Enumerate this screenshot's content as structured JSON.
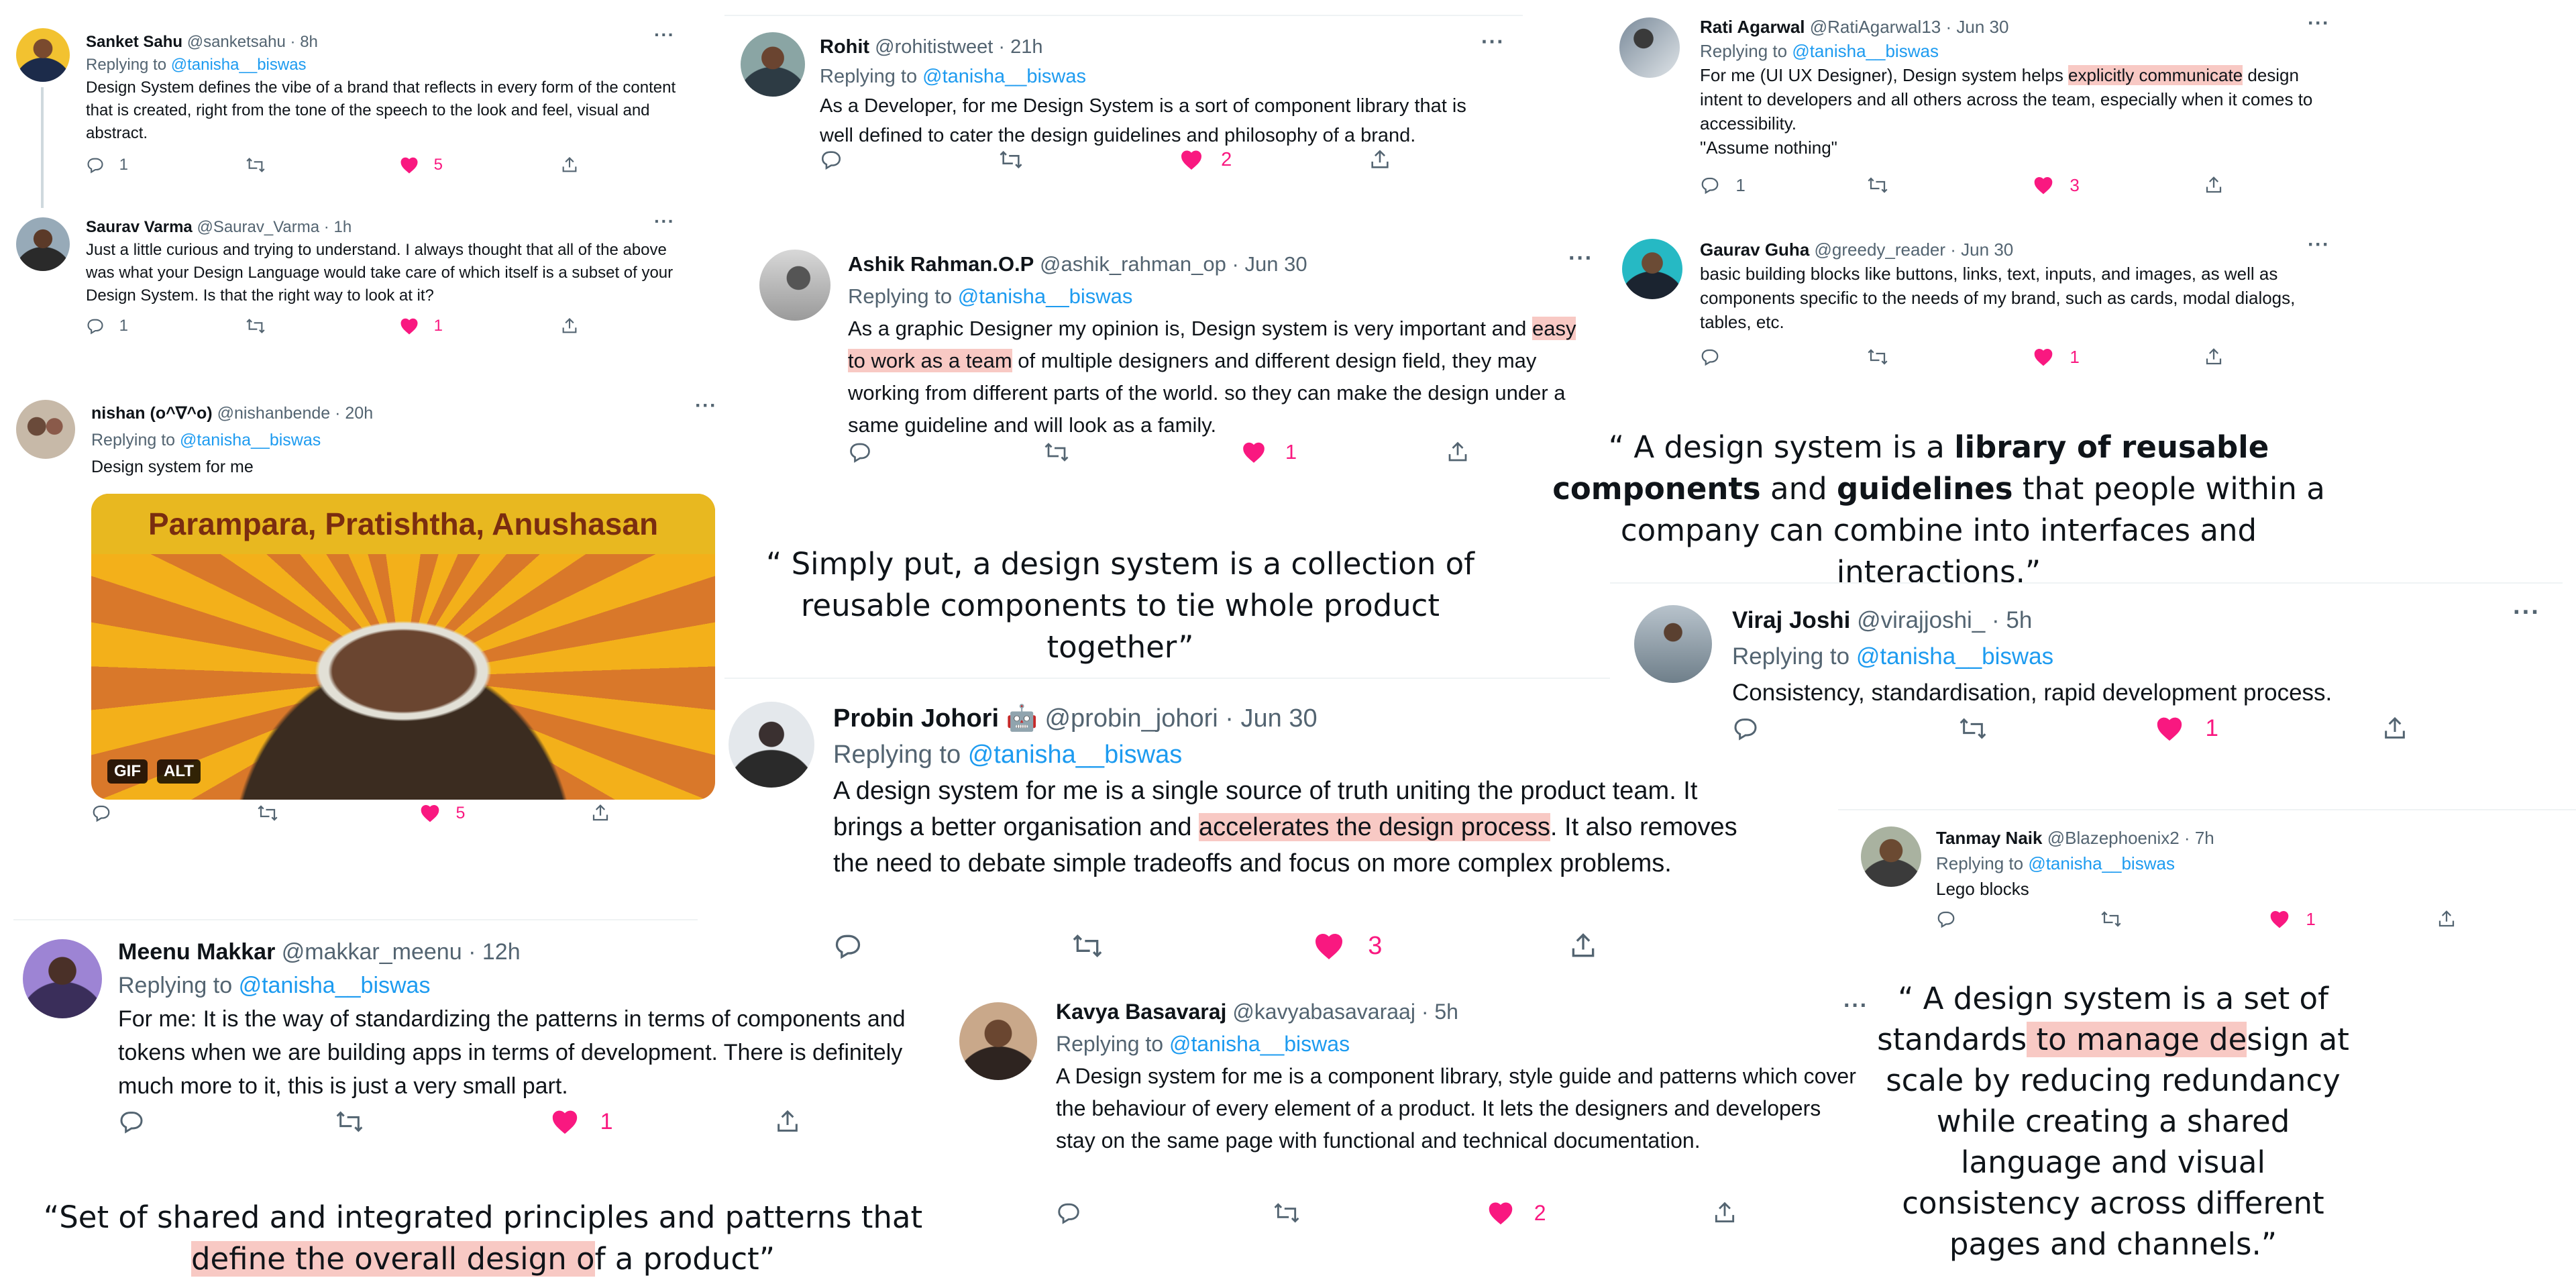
{
  "colors": {
    "accent": "#1d9bf0",
    "like": "#f91880",
    "highlight": "#f8c9c4",
    "muted": "#536471"
  },
  "tweets": {
    "sanket": {
      "name": "Sanket Sahu",
      "handle": "@sanketsahu",
      "dot": "·",
      "time": "8h",
      "replying": "Replying to",
      "mention": "@tanisha__biswas",
      "text": "Design System defines the vibe of a brand that reflects in every form of the content that is created, right from the tone of the speech to the look and feel, visual and abstract.",
      "replies": "1",
      "retweets": "",
      "likes": "5"
    },
    "saurav": {
      "name": "Saurav Varma",
      "handle": "@Saurav_Varma",
      "dot": "·",
      "time": "1h",
      "text": "Just a little curious and trying to understand. I always thought that all of the above was what your Design Language would take care of which itself is a subset of your Design System. Is that the right way to look at it?",
      "replies": "1",
      "retweets": "",
      "likes": "1"
    },
    "nishan": {
      "name": "nishan (o^∇^o)",
      "handle": "@nishanbende",
      "dot": "·",
      "time": "20h",
      "replying": "Replying to",
      "mention": "@tanisha__biswas",
      "text": "Design system for me",
      "gif_caption": "Parampara, Pratishtha, Anushasan",
      "gif_badge": "GIF",
      "alt_badge": "ALT",
      "replies": "",
      "retweets": "",
      "likes": "5"
    },
    "rohit": {
      "name": "Rohit",
      "handle": "@rohitistweet",
      "dot": "·",
      "time": "21h",
      "replying": "Replying to",
      "mention": "@tanisha__biswas",
      "text": "As a Developer, for me Design System is a sort of component library that is well defined to cater the design guidelines and philosophy of a brand.",
      "replies": "",
      "retweets": "",
      "likes": "2"
    },
    "ashik": {
      "name": "Ashik Rahman.O.P",
      "handle": "@ashik_rahman_op",
      "dot": "·",
      "time": "Jun 30",
      "replying": "Replying to",
      "mention": "@tanisha__biswas",
      "text_a": "As a graphic Designer my opinion is, Design system is very important and ",
      "text_hl": "easy to work as a team",
      "text_b": " of multiple designers and different design field, they may working from different parts of the world. so they can make the design under a same guideline and will look as a family.",
      "replies": "",
      "retweets": "",
      "likes": "1"
    },
    "rati": {
      "name": "Rati Agarwal",
      "handle": "@RatiAgarwal13",
      "dot": "·",
      "time": "Jun 30",
      "replying": "Replying to",
      "mention": "@tanisha__biswas",
      "text_a": "For me (UI UX Designer), Design system helps ",
      "text_hl": "explicitly communicate",
      "text_b": " design intent to developers and all others across the team, especially when it comes to accessibility.",
      "text_c": "\"Assume nothing\"",
      "replies": "1",
      "retweets": "",
      "likes": "3"
    },
    "gaurav": {
      "name": "Gaurav Guha",
      "handle": "@greedy_reader",
      "dot": "·",
      "time": "Jun 30",
      "text": "basic building blocks like buttons, links, text, inputs, and images, as well as components specific to the needs of my brand, such as cards, modal dialogs, tables, etc.",
      "replies": "",
      "retweets": "",
      "likes": "1"
    },
    "viraj": {
      "name": "Viraj Joshi",
      "handle": "@virajjoshi_",
      "dot": "·",
      "time": "5h",
      "replying": "Replying to",
      "mention": "@tanisha__biswas",
      "text": "Consistency, standardisation, rapid development process.",
      "replies": "",
      "retweets": "",
      "likes": "1"
    },
    "probin": {
      "name": "Probin Johori",
      "emoji": "🤖",
      "handle": "@probin_johori",
      "dot": "·",
      "time": "Jun 30",
      "replying": "Replying to",
      "mention": "@tanisha__biswas",
      "text_a": "A design system for me is a single source of truth uniting the product team. It brings a better organisation and ",
      "text_hl": "accelerates the design process",
      "text_b": ". It also removes the need to debate simple tradeoffs and focus on more complex problems.",
      "replies": "",
      "retweets": "",
      "likes": "3"
    },
    "tanmay": {
      "name": "Tanmay Naik",
      "handle": "@Blazephoenix2",
      "dot": "·",
      "time": "7h",
      "replying": "Replying to",
      "mention": "@tanisha__biswas",
      "text": "Lego blocks",
      "replies": "",
      "retweets": "",
      "likes": "1"
    },
    "meenu": {
      "name": "Meenu Makkar",
      "handle": "@makkar_meenu",
      "dot": "·",
      "time": "12h",
      "replying": "Replying to",
      "mention": "@tanisha__biswas",
      "text": "For me: It is the way of standardizing the patterns in terms of components and tokens when we are building apps in terms of development. There is definitely much more to it, this is just a very small part.",
      "replies": "",
      "retweets": "",
      "likes": "1"
    },
    "kavya": {
      "name": "Kavya Basavaraj",
      "handle": "@kavyabasavaraaj",
      "dot": "·",
      "time": "5h",
      "replying": "Replying to",
      "mention": "@tanisha__biswas",
      "text": "A Design system for me is a component library, style guide and patterns which cover the behaviour of every element of a product. It lets the designers and developers stay on the same page with functional and technical documentation.",
      "replies": "",
      "retweets": "",
      "likes": "2"
    }
  },
  "quotes": {
    "simply": {
      "text": "“ Simply put, a design system is a collection of reusable components to tie whole product together”"
    },
    "library": {
      "open": "“ A design system is a ",
      "b1": "library of reusable components",
      "mid1": " and ",
      "b2": "guidelines",
      "rest": " that people within a company can combine into interfaces and interactions.”"
    },
    "set": {
      "a": "“Set of shared and integrated principles and patterns that ",
      "hl": "define the overall design o",
      "b": "f a product”"
    },
    "standards": {
      "a": "“ A design system is a set of standards",
      "hl": " to manage de",
      "b": "sign at scale by reducing redundancy while creating a shared language and visual consistency across different pages and channels.”"
    }
  }
}
